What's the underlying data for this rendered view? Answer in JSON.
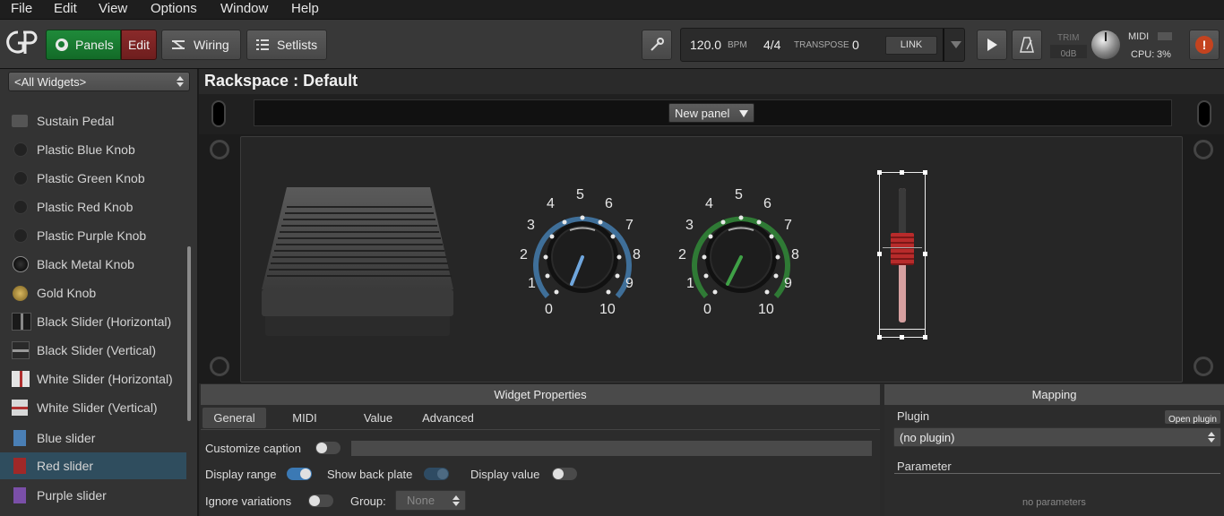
{
  "menu": [
    "File",
    "Edit",
    "View",
    "Options",
    "Window",
    "Help"
  ],
  "toolbar": {
    "panels_label": "Panels",
    "edit_label": "Edit",
    "wiring_label": "Wiring",
    "setlists_label": "Setlists",
    "bpm_value": "120.0",
    "bpm_label": "BPM",
    "time_signature": "4/4",
    "transpose_label": "TRANSPOSE",
    "transpose_value": "0",
    "link_label": "LINK",
    "trim_label": "TRIM",
    "trim_value": "0dB",
    "midi_label": "MIDI",
    "cpu_label": "CPU:",
    "cpu_value": "3%"
  },
  "sidebar": {
    "filter_value": "<All Widgets>",
    "items": [
      {
        "label": "Sustain Pedal",
        "icon": "pedal-icon",
        "color": "#555555"
      },
      {
        "label": "Plastic Blue Knob",
        "icon": "knob-icon",
        "color": "#2a2a2a"
      },
      {
        "label": "Plastic Green Knob",
        "icon": "knob-icon",
        "color": "#2a2a2a"
      },
      {
        "label": "Plastic Red Knob",
        "icon": "knob-icon",
        "color": "#2a2a2a"
      },
      {
        "label": "Plastic Purple Knob",
        "icon": "knob-icon",
        "color": "#2a2a2a"
      },
      {
        "label": "Black Metal Knob",
        "icon": "knob-icon",
        "color": "#111111"
      },
      {
        "label": "Gold Knob",
        "icon": "knob-icon",
        "color": "#a88a3a"
      },
      {
        "label": "Black Slider (Horizontal)",
        "icon": "slider-icon",
        "color": "#222222"
      },
      {
        "label": "Black Slider (Vertical)",
        "icon": "slider-icon",
        "color": "#333333"
      },
      {
        "label": "White Slider (Horizontal)",
        "icon": "slider-icon",
        "color": "#dddddd"
      },
      {
        "label": "White Slider (Vertical)",
        "icon": "slider-icon",
        "color": "#cccccc"
      },
      {
        "label": "Blue slider",
        "icon": "slider-icon",
        "color": "#4a7fb5"
      },
      {
        "label": "Red slider",
        "icon": "slider-icon",
        "color": "#a02828"
      },
      {
        "label": "Purple slider",
        "icon": "slider-icon",
        "color": "#7a4fa8"
      }
    ]
  },
  "rackspace": {
    "title": "Rackspace : Default",
    "panel_select": "New panel"
  },
  "dials": {
    "numbers": [
      "0",
      "1",
      "2",
      "3",
      "4",
      "5",
      "6",
      "7",
      "8",
      "9",
      "10"
    ],
    "blue_color": "#3f6f99",
    "green_color": "#2f7a35"
  },
  "widget_properties": {
    "title": "Widget Properties",
    "tabs": [
      "General",
      "MIDI",
      "Value",
      "Advanced"
    ],
    "customize_caption": "Customize caption",
    "display_range": "Display range",
    "show_back_plate": "Show back plate",
    "display_value": "Display value",
    "ignore_variations": "Ignore variations",
    "group_label": "Group:",
    "group_value": "None"
  },
  "mapping": {
    "title": "Mapping",
    "plugin_label": "Plugin",
    "open_plugin": "Open plugin",
    "plugin_value": "(no plugin)",
    "parameter_label": "Parameter",
    "no_parameters": "no parameters"
  }
}
